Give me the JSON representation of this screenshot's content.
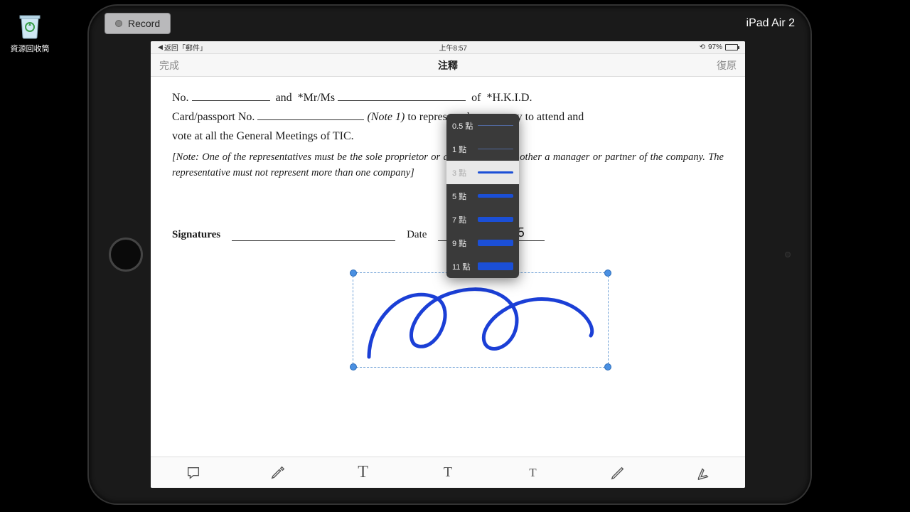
{
  "desktop": {
    "recycle_bin": "資源回收筒"
  },
  "overlay": {
    "record": "Record",
    "device": "iPad Air 2"
  },
  "statusbar": {
    "back": "返回「郵件」",
    "time": "上午8:57",
    "battery": "97%"
  },
  "nav": {
    "left": "完成",
    "title": "注釋",
    "right": "復原"
  },
  "doc": {
    "l1a": "No.",
    "l1b": "and",
    "l1c": "*Mr/Ms",
    "l1d": "of",
    "l1e": "*H.K.I.D.",
    "l2a": "Card/passport No.",
    "l2b": "(Note 1)",
    "l2c": "to represent the company to attend and",
    "l3": "vote at all the General Meetings of TIC.",
    "note": "[Note: One of the representatives must be the sole proprietor or a partner and the other a manager or partner of the company. The representative must not represent more than one company]",
    "sig_label": "Signatures",
    "date_label": "Date",
    "date_value": "11/06/2015"
  },
  "popover": {
    "options": [
      {
        "label": "0.5 點",
        "h": 1
      },
      {
        "label": "1 點",
        "h": 1.5
      },
      {
        "label": "3 點",
        "h": 3,
        "selected": true
      },
      {
        "label": "5 點",
        "h": 5
      },
      {
        "label": "7 點",
        "h": 7
      },
      {
        "label": "9 點",
        "h": 9
      },
      {
        "label": "11 點",
        "h": 11
      }
    ]
  },
  "toolbar": {
    "t1": "comment-icon",
    "t2": "highlighter-icon",
    "t3": "text-big-icon",
    "t4": "text-mid-icon",
    "t5": "text-small-icon",
    "t6": "pen-icon",
    "t7": "stamp-icon"
  }
}
